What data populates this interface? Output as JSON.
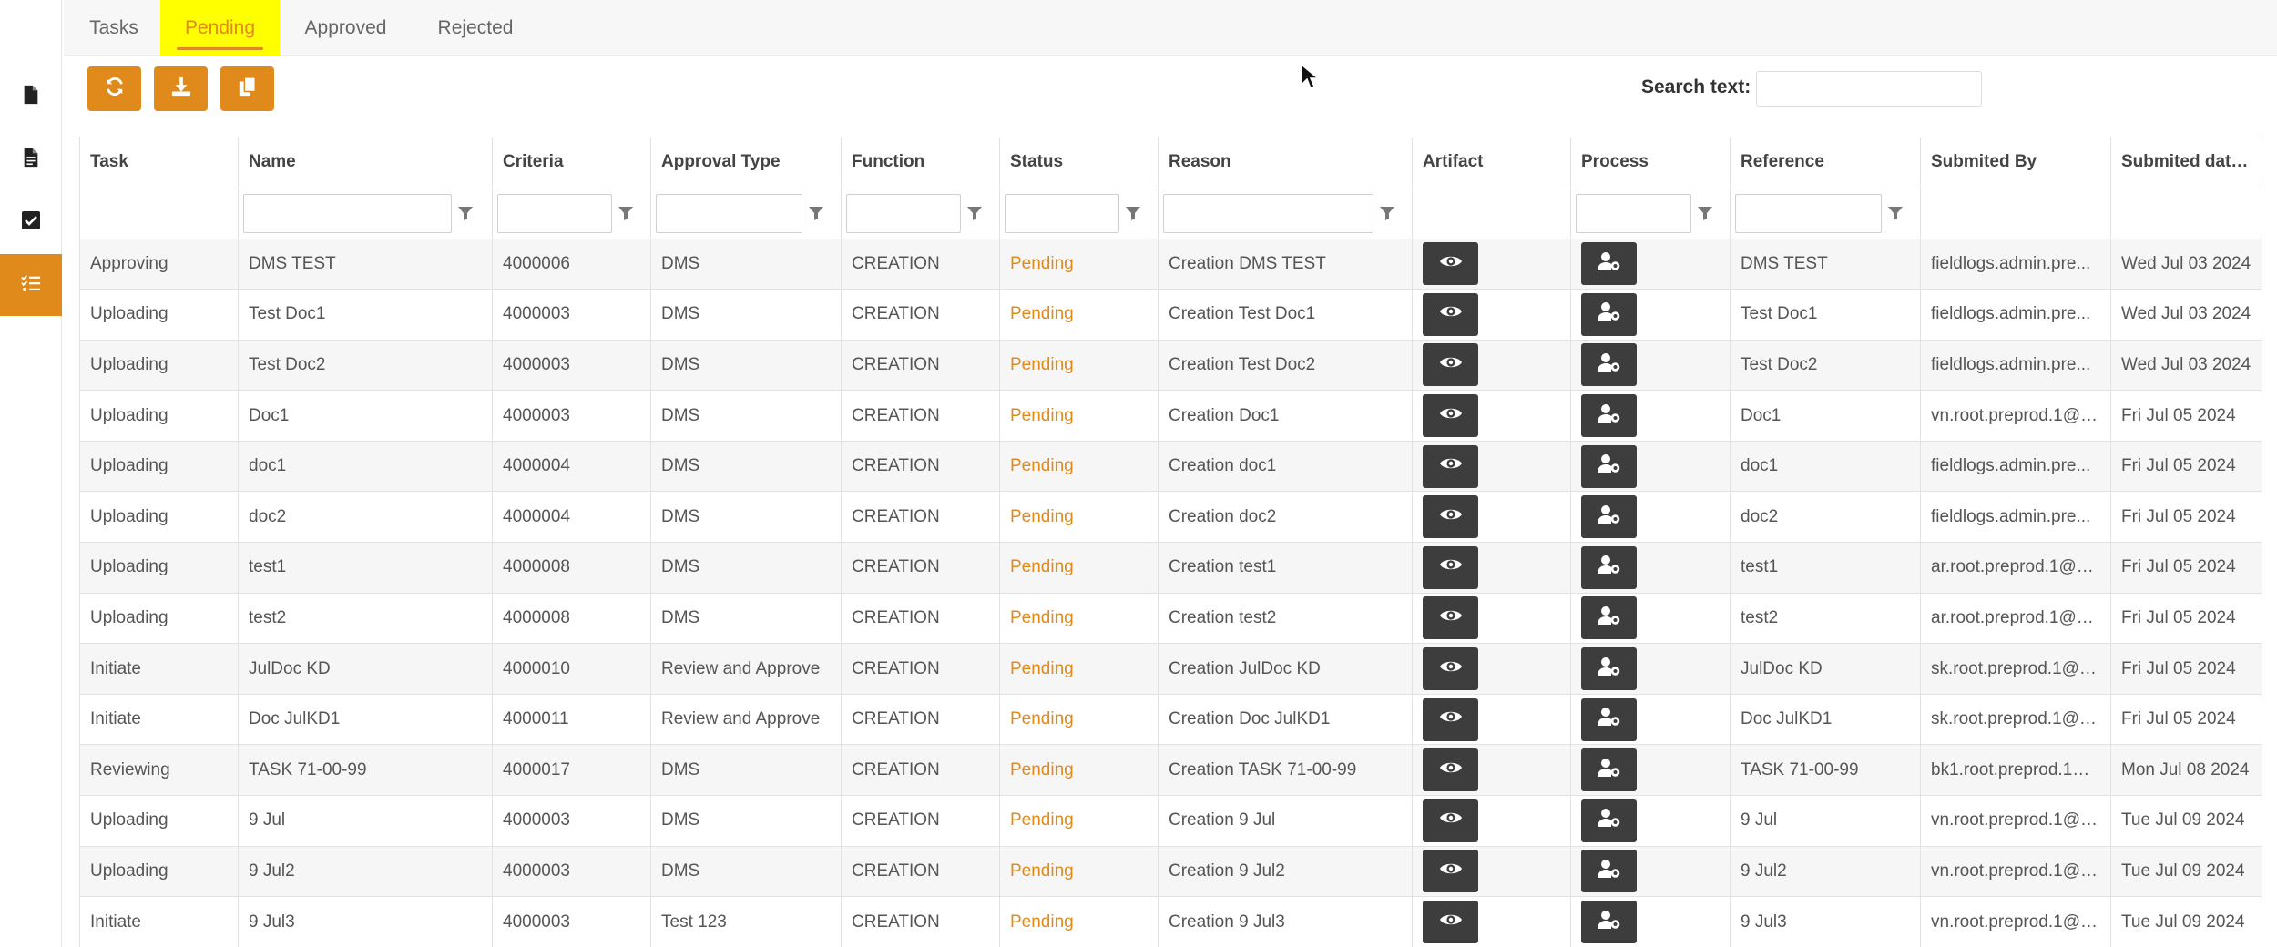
{
  "tabs": [
    {
      "label": "Tasks"
    },
    {
      "label": "Pending"
    },
    {
      "label": "Approved"
    },
    {
      "label": "Rejected"
    }
  ],
  "active_tab": "Pending",
  "colors": {
    "accent": "#e08a1c",
    "tab_highlight": "#ffff00",
    "action_button": "#3d3d3d"
  },
  "sidebar": {
    "items": [
      {
        "icon": "document-icon"
      },
      {
        "icon": "document-lines-icon"
      },
      {
        "icon": "checkbox-icon"
      },
      {
        "icon": "task-list-icon",
        "active": true
      }
    ]
  },
  "toolbar": {
    "buttons": [
      {
        "icon": "refresh-icon"
      },
      {
        "icon": "download-icon"
      },
      {
        "icon": "copy-icon"
      }
    ]
  },
  "search": {
    "label": "Search text:",
    "value": ""
  },
  "table": {
    "columns": [
      "Task",
      "Name",
      "Criteria",
      "Approval Type",
      "Function",
      "Status",
      "Reason",
      "Artifact",
      "Process",
      "Reference",
      "Submited By",
      "Submited date..."
    ],
    "rows": [
      [
        "Approving",
        "DMS TEST",
        "4000006",
        "DMS",
        "CREATION",
        "Pending",
        "Creation DMS TEST",
        "DMS TEST",
        "fieldlogs.admin.pre...",
        "Wed Jul 03 2024"
      ],
      [
        "Uploading",
        "Test Doc1",
        "4000003",
        "DMS",
        "CREATION",
        "Pending",
        "Creation Test Doc1",
        "Test Doc1",
        "fieldlogs.admin.pre...",
        "Wed Jul 03 2024"
      ],
      [
        "Uploading",
        "Test Doc2",
        "4000003",
        "DMS",
        "CREATION",
        "Pending",
        "Creation Test Doc2",
        "Test Doc2",
        "fieldlogs.admin.pre...",
        "Wed Jul 03 2024"
      ],
      [
        "Uploading",
        "Doc1",
        "4000003",
        "DMS",
        "CREATION",
        "Pending",
        "Creation Doc1",
        "Doc1",
        "vn.root.preprod.1@p...",
        "Fri Jul 05 2024"
      ],
      [
        "Uploading",
        "doc1",
        "4000004",
        "DMS",
        "CREATION",
        "Pending",
        "Creation doc1",
        "doc1",
        "fieldlogs.admin.pre...",
        "Fri Jul 05 2024"
      ],
      [
        "Uploading",
        "doc2",
        "4000004",
        "DMS",
        "CREATION",
        "Pending",
        "Creation doc2",
        "doc2",
        "fieldlogs.admin.pre...",
        "Fri Jul 05 2024"
      ],
      [
        "Uploading",
        "test1",
        "4000008",
        "DMS",
        "CREATION",
        "Pending",
        "Creation test1",
        "test1",
        "ar.root.preprod.1@pt...",
        "Fri Jul 05 2024"
      ],
      [
        "Uploading",
        "test2",
        "4000008",
        "DMS",
        "CREATION",
        "Pending",
        "Creation test2",
        "test2",
        "ar.root.preprod.1@pt...",
        "Fri Jul 05 2024"
      ],
      [
        "Initiate",
        "JulDoc KD",
        "4000010",
        "Review and Approve",
        "CREATION",
        "Pending",
        "Creation JulDoc KD",
        "JulDoc KD",
        "sk.root.preprod.1@p...",
        "Fri Jul 05 2024"
      ],
      [
        "Initiate",
        "Doc JulKD1",
        "4000011",
        "Review and Approve",
        "CREATION",
        "Pending",
        "Creation Doc JulKD1",
        "Doc JulKD1",
        "sk.root.preprod.1@p...",
        "Fri Jul 05 2024"
      ],
      [
        "Reviewing",
        "TASK 71-00-99",
        "4000017",
        "DMS",
        "CREATION",
        "Pending",
        "Creation TASK 71-00-99",
        "TASK 71-00-99",
        "bk1.root.preprod.1@...",
        "Mon Jul 08 2024"
      ],
      [
        "Uploading",
        "9 Jul",
        "4000003",
        "DMS",
        "CREATION",
        "Pending",
        "Creation 9 Jul",
        "9 Jul",
        "vn.root.preprod.1@p...",
        "Tue Jul 09 2024"
      ],
      [
        "Uploading",
        "9 Jul2",
        "4000003",
        "DMS",
        "CREATION",
        "Pending",
        "Creation 9 Jul2",
        "9 Jul2",
        "vn.root.preprod.1@p...",
        "Tue Jul 09 2024"
      ],
      [
        "Initiate",
        "9 Jul3",
        "4000003",
        "Test 123",
        "CREATION",
        "Pending",
        "Creation 9 Jul3",
        "9 Jul3",
        "vn.root.preprod.1@p...",
        "Tue Jul 09 2024"
      ]
    ]
  }
}
